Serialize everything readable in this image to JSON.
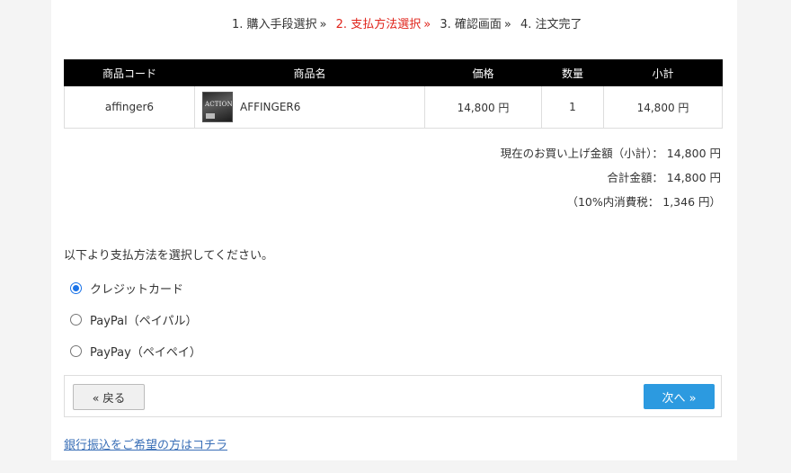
{
  "steps": [
    {
      "label": "1. 購入手段選択",
      "sep": "»"
    },
    {
      "label": "2. 支払方法選択",
      "sep": "»"
    },
    {
      "label": "3. 確認画面",
      "sep": "»"
    },
    {
      "label": "4. 注文完了",
      "sep": ""
    }
  ],
  "colors": {
    "active_step": "#e0241b",
    "next_button": "#2c9ae0",
    "link": "#3a6fb7",
    "header_bg": "#000000"
  },
  "cart": {
    "headers": {
      "code": "商品コード",
      "name": "商品名",
      "price": "価格",
      "qty": "数量",
      "subtotal": "小計"
    },
    "rows": [
      {
        "code": "affinger6",
        "thumb_text": "ACTION",
        "name": "AFFINGER6",
        "price": "14,800 円",
        "qty": "1",
        "subtotal": "14,800 円"
      }
    ]
  },
  "summary": {
    "subtotal_line": "現在のお買い上げ金額（小計）： 14,800 円",
    "total_line": "合計金額： 14,800 円",
    "tax_line": "（10%内消費税： 1,346 円）"
  },
  "payment": {
    "prompt": "以下より支払方法を選択してください。",
    "options": [
      {
        "label": "クレジットカード",
        "selected": true
      },
      {
        "label": "PayPal（ペイパル）",
        "selected": false
      },
      {
        "label": "PayPay（ペイペイ）",
        "selected": false
      }
    ]
  },
  "buttons": {
    "back": "« 戻る",
    "next": "次へ »"
  },
  "bank_link": "銀行振込をご希望の方はコチラ"
}
